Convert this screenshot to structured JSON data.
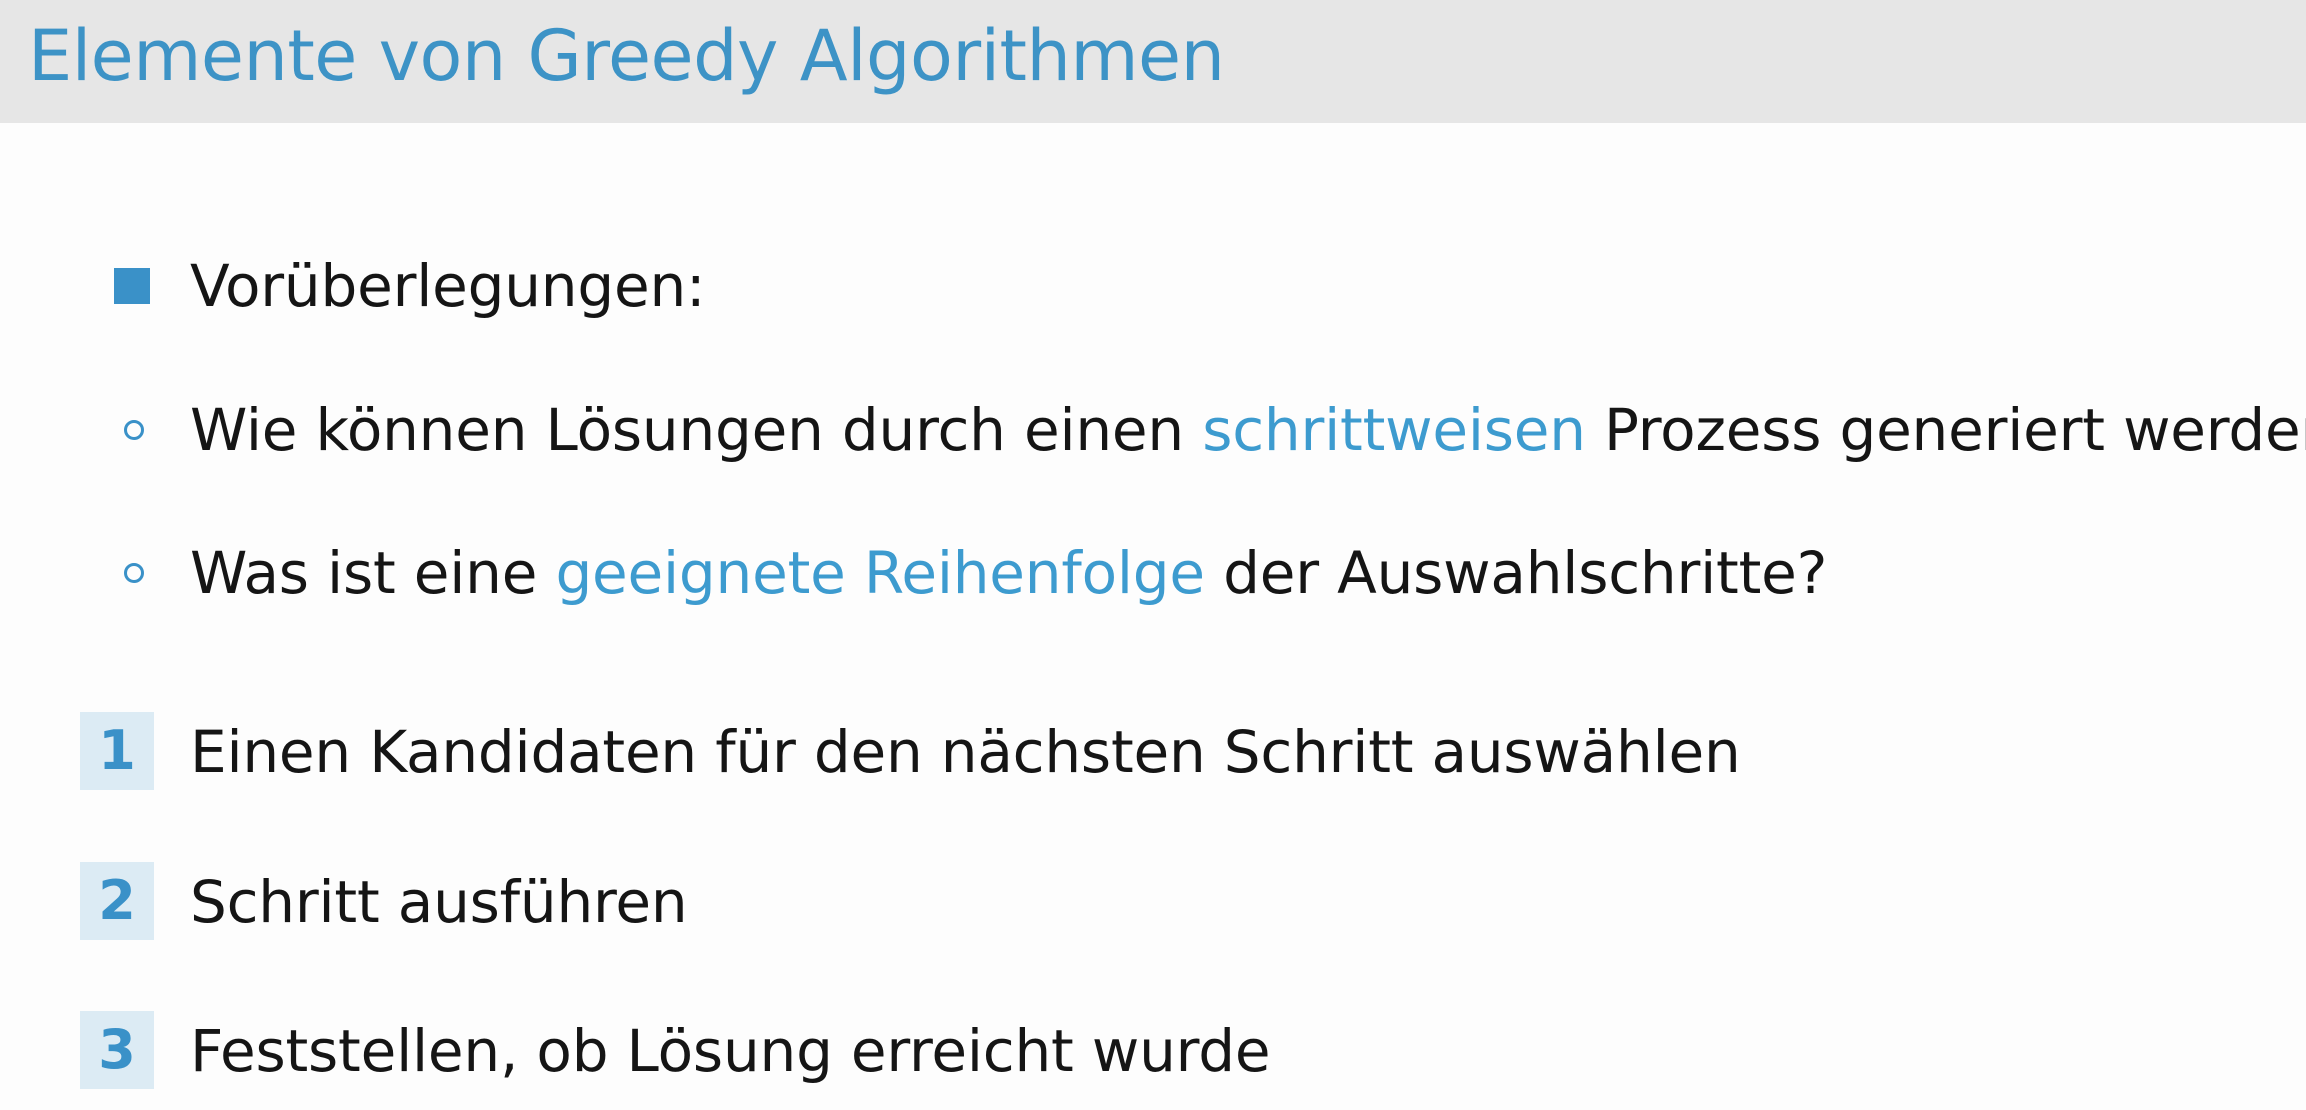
{
  "slide": {
    "title": "Elemente von Greedy Algorithmen"
  },
  "bullets": {
    "main": {
      "label": "Vorüberlegungen:"
    },
    "sub1": {
      "before": "Wie können Lösungen durch einen ",
      "highlight": "schrittweisen",
      "after": " Prozess generiert werden?"
    },
    "sub2": {
      "before": "Was ist eine ",
      "highlight": "geeignete Reihenfolge",
      "after": " der Auswahlschritte?"
    }
  },
  "steps": [
    {
      "number": "1",
      "text": "Einen Kandidaten für den nächsten Schritt auswählen"
    },
    {
      "number": "2",
      "text": "Schritt ausführen"
    },
    {
      "number": "3",
      "text": "Feststellen, ob Lösung erreicht wurde"
    }
  ],
  "colors": {
    "accent": "#3a91c8",
    "title_bar": "#e6e6e6",
    "number_box": "#dcebf4"
  }
}
